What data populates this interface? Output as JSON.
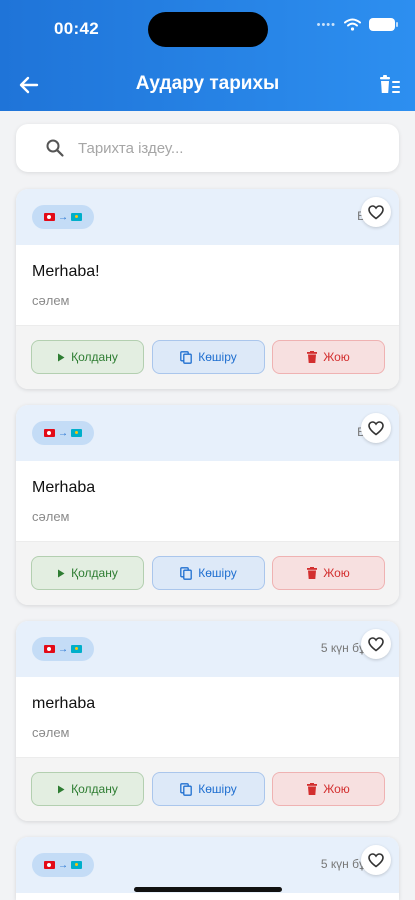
{
  "status_bar": {
    "time": "00:42",
    "signal": "••••"
  },
  "header": {
    "title": "Аудару тарихы"
  },
  "search": {
    "placeholder": "Тарихта іздеу..."
  },
  "cards": [
    {
      "source": "Merhaba!",
      "target": "сәлем",
      "time": "Б",
      "actions": {
        "use": "Қолдану",
        "copy": "Көшіру",
        "delete": "Жою"
      }
    },
    {
      "source": "Merhaba",
      "target": "сәлем",
      "time": "Б",
      "actions": {
        "use": "Қолдану",
        "copy": "Көшіру",
        "delete": "Жою"
      }
    },
    {
      "source": "merhaba",
      "target": "сәлем",
      "time": "5 күн бұ",
      "actions": {
        "use": "Қолдану",
        "copy": "Көшіру",
        "delete": "Жою"
      }
    },
    {
      "time": "5 күн бұ"
    }
  ],
  "colors": {
    "header": "#1f74d8",
    "use": "#2e7d32",
    "copy": "#1f6fd0",
    "delete": "#d32f2f"
  },
  "icons": {
    "back": "arrow-left-icon",
    "clear": "clear-history-icon",
    "search": "search-icon",
    "favorite": "heart-icon"
  }
}
